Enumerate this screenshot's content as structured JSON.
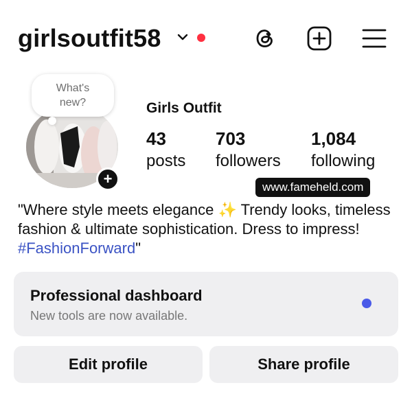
{
  "header": {
    "username": "girlsoutfit58",
    "notification_color": "#ff3040",
    "icons": [
      "chevron-down-icon",
      "threads-icon",
      "create-plus-icon",
      "menu-icon"
    ]
  },
  "note": {
    "text_line1": "What's",
    "text_line2": "new?"
  },
  "profile": {
    "display_name": "Girls Outfit",
    "avatar_add": "+",
    "stats": {
      "posts": {
        "count": "43",
        "label": "posts"
      },
      "followers": {
        "count": "703",
        "label": "followers"
      },
      "following": {
        "count": "1,084",
        "label": "following"
      }
    },
    "link": "www.fameheld.com",
    "bio_text": "\"Where style meets elegance ✨ Trendy looks, timeless fashion & ultimate sophistication. Dress to impress! ",
    "bio_hashtag": "#FashionForward",
    "bio_end": "\"",
    "hashtag_color": "#3b53c4"
  },
  "dashboard": {
    "title": "Professional dashboard",
    "subtitle": "New tools are now available.",
    "dot_color": "#4a5ae8"
  },
  "actions": {
    "edit_label": "Edit profile",
    "share_label": "Share profile"
  }
}
